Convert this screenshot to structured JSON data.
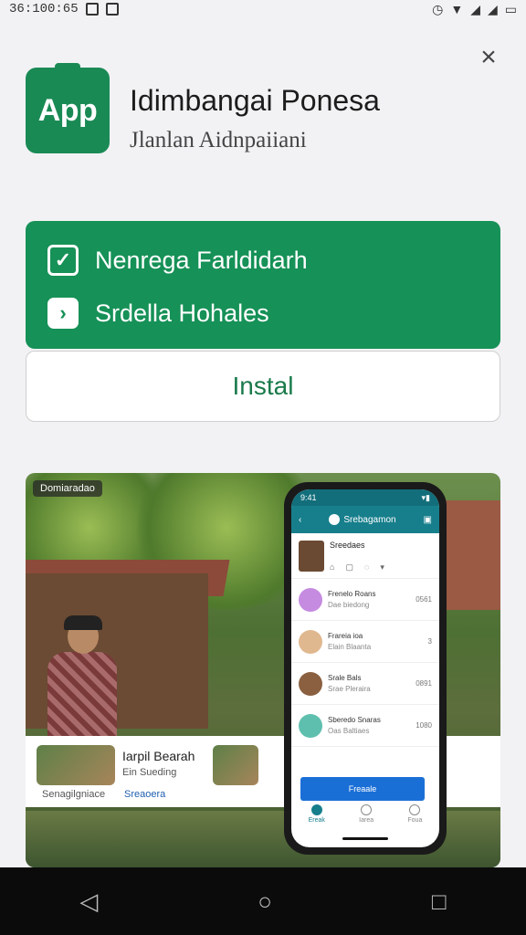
{
  "status": {
    "time": "36:100:65",
    "right_icons": [
      "alarm-icon",
      "wifi-icon",
      "signal-icon",
      "signal-icon",
      "battery-icon"
    ]
  },
  "app": {
    "icon_text": "App",
    "title": "Idimbangai Ponesa",
    "subtitle": "Jlanlan Aidnpaiiani"
  },
  "features": [
    {
      "icon": "checkbox-icon",
      "label": "Nenrega Farldidarh"
    },
    {
      "icon": "chevron-right-icon",
      "label": "Srdella Hohales"
    }
  ],
  "install_label": "Instal",
  "screenshot": {
    "tag": "Domiaradao",
    "strip_title": "Iarpil Bearah",
    "strip_sub": "Ein Sueding",
    "strip_foot1": "Senagilgniace",
    "strip_foot2": "Sreaoera",
    "phone": {
      "status_time": "9:41",
      "header": "Srebagamon",
      "profile_name": "Sreedaes",
      "items": [
        {
          "title": "Frenelo Roans",
          "sub": "Dae biedong",
          "num": "0561",
          "color": "#c58be0"
        },
        {
          "title": "Frareia ioa",
          "sub": "Elain Blaanta",
          "num": "3",
          "color": "#e0b88f"
        },
        {
          "title": "Srale Bals",
          "sub": "Srae Pleraira",
          "num": "0891",
          "color": "#8a6040"
        },
        {
          "title": "Sberedo Snaras",
          "sub": "Oas Baltiaes",
          "num": "1080",
          "color": "#5fbfae"
        }
      ],
      "button": "Freaale",
      "tabs": [
        "Ereak",
        "Iarea",
        "Foua"
      ]
    }
  },
  "nav": [
    "back-icon",
    "home-icon",
    "recents-icon"
  ]
}
